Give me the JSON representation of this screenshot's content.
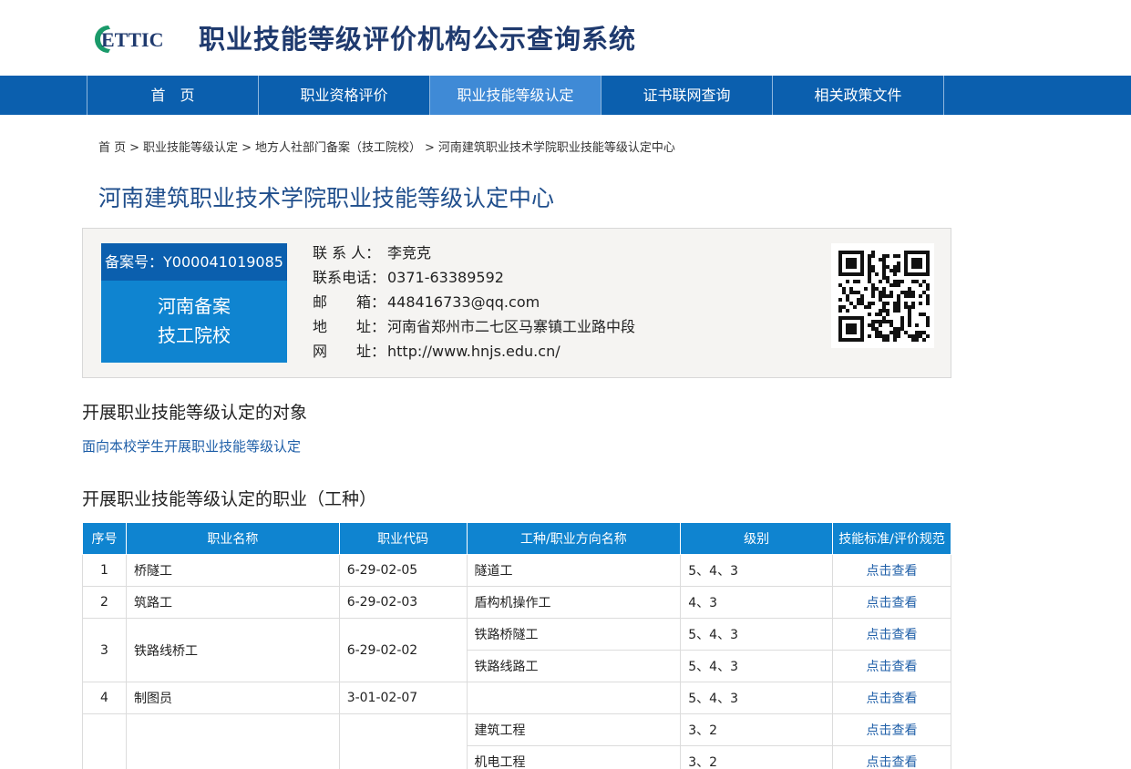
{
  "header": {
    "logo_text": "ETTIC",
    "site_title": "职业技能等级评价机构公示查询系统"
  },
  "nav": {
    "items": [
      {
        "label": "首　页"
      },
      {
        "label": "职业资格评价"
      },
      {
        "label": "职业技能等级认定"
      },
      {
        "label": "证书联网查询"
      },
      {
        "label": "相关政策文件"
      }
    ],
    "active_index": 2
  },
  "breadcrumb": {
    "items": [
      "首 页",
      "职业技能等级认定",
      "地方人社部门备案（技工院校）",
      "河南建筑职业技术学院职业技能等级认定中心"
    ],
    "separator": ">"
  },
  "page_title": "河南建筑职业技术学院职业技能等级认定中心",
  "info": {
    "record_no": "备案号：Y000041019085",
    "badge_line1": "河南备案",
    "badge_line2": "技工院校",
    "contact": [
      {
        "label": "联 系 人：",
        "value": "李竞克"
      },
      {
        "label": "联系电话：",
        "value": "0371-63389592"
      },
      {
        "label": "邮　　箱：",
        "value": "448416733@qq.com"
      },
      {
        "label": "地　　址：",
        "value": "河南省郑州市二七区马寨镇工业路中段"
      },
      {
        "label": "网　　址：",
        "value": "http://www.hnjs.edu.cn/"
      }
    ]
  },
  "sections": {
    "objects_title": "开展职业技能等级认定的对象",
    "objects_desc": "面向本校学生开展职业技能等级认定",
    "occupations_title": "开展职业技能等级认定的职业（工种）"
  },
  "table": {
    "headers": [
      "序号",
      "职业名称",
      "职业代码",
      "工种/职业方向名称",
      "级别",
      "技能标准/评价规范"
    ],
    "link_label": "点击查看",
    "rows": [
      {
        "no": "1",
        "name": "桥隧工",
        "code": "6-29-02-05",
        "sub": [
          {
            "dir": "隧道工",
            "level": "5、4、3"
          }
        ]
      },
      {
        "no": "2",
        "name": "筑路工",
        "code": "6-29-02-03",
        "sub": [
          {
            "dir": "盾构机操作工",
            "level": "4、3"
          }
        ]
      },
      {
        "no": "3",
        "name": "铁路线桥工",
        "code": "6-29-02-02",
        "sub": [
          {
            "dir": "铁路桥隧工",
            "level": "5、4、3"
          },
          {
            "dir": "铁路线路工",
            "level": "5、4、3"
          }
        ]
      },
      {
        "no": "4",
        "name": "制图员",
        "code": "3-01-02-07",
        "sub": [
          {
            "dir": "",
            "level": "5、4、3"
          }
        ]
      },
      {
        "no": "",
        "name": "",
        "code": "",
        "sub": [
          {
            "dir": "建筑工程",
            "level": "3、2"
          },
          {
            "dir": "机电工程",
            "level": "3、2"
          }
        ]
      }
    ]
  },
  "colors": {
    "nav_bg": "#0b5fae",
    "nav_active": "#3f8ad6",
    "table_header": "#0f84d0",
    "title_blue": "#1f4e8c",
    "link_blue": "#1f5fa8"
  }
}
